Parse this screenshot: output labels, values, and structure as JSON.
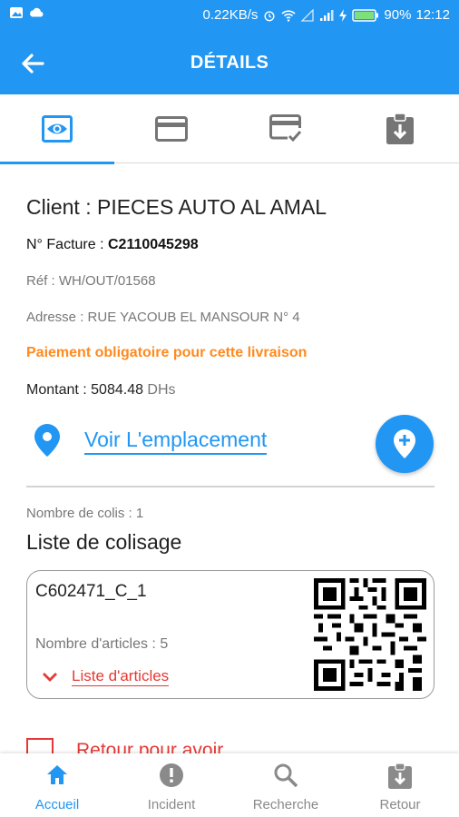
{
  "status_bar": {
    "speed": "0.22KB/s",
    "battery": "90%",
    "time": "12:12"
  },
  "appbar": {
    "title": "DÉTAILS",
    "back_icon": "arrow-left-icon"
  },
  "tabs": [
    {
      "icon": "eye-icon",
      "active": true
    },
    {
      "icon": "credit-card-icon",
      "active": false
    },
    {
      "icon": "card-check-icon",
      "active": false
    },
    {
      "icon": "clipboard-download-icon",
      "active": false
    }
  ],
  "details": {
    "client": "Client : PIECES AUTO AL AMAL",
    "facture_label": "N° Facture : ",
    "facture_value": "C2110045298",
    "ref": "Réf : WH/OUT/01568",
    "adresse": "Adresse : RUE YACOUB EL MANSOUR N° 4",
    "warning": "Paiement obligatoire pour cette livraison",
    "montant_label": "Montant : 5084.48",
    "montant_unit": " DHs"
  },
  "location": {
    "link_label": "Voir L'emplacement"
  },
  "colisage": {
    "nb_colis": "Nombre de colis : 1",
    "title": "Liste de colisage",
    "items": [
      {
        "code": "C602471_C_1",
        "nb_articles": "Nombre d'articles : 5",
        "link_label": "Liste d'articles"
      }
    ]
  },
  "retour": {
    "label": "Retour pour avoir"
  },
  "bottom_nav": [
    {
      "label": "Accueil",
      "icon": "home-icon",
      "active": true
    },
    {
      "label": "Incident",
      "icon": "alert-circle-icon",
      "active": false
    },
    {
      "label": "Recherche",
      "icon": "search-icon",
      "active": false
    },
    {
      "label": "Retour",
      "icon": "clipboard-return-icon",
      "active": false
    }
  ],
  "colors": {
    "primary": "#2196f3",
    "warning": "#ff8a1e",
    "danger": "#e53935",
    "muted": "#777777"
  }
}
